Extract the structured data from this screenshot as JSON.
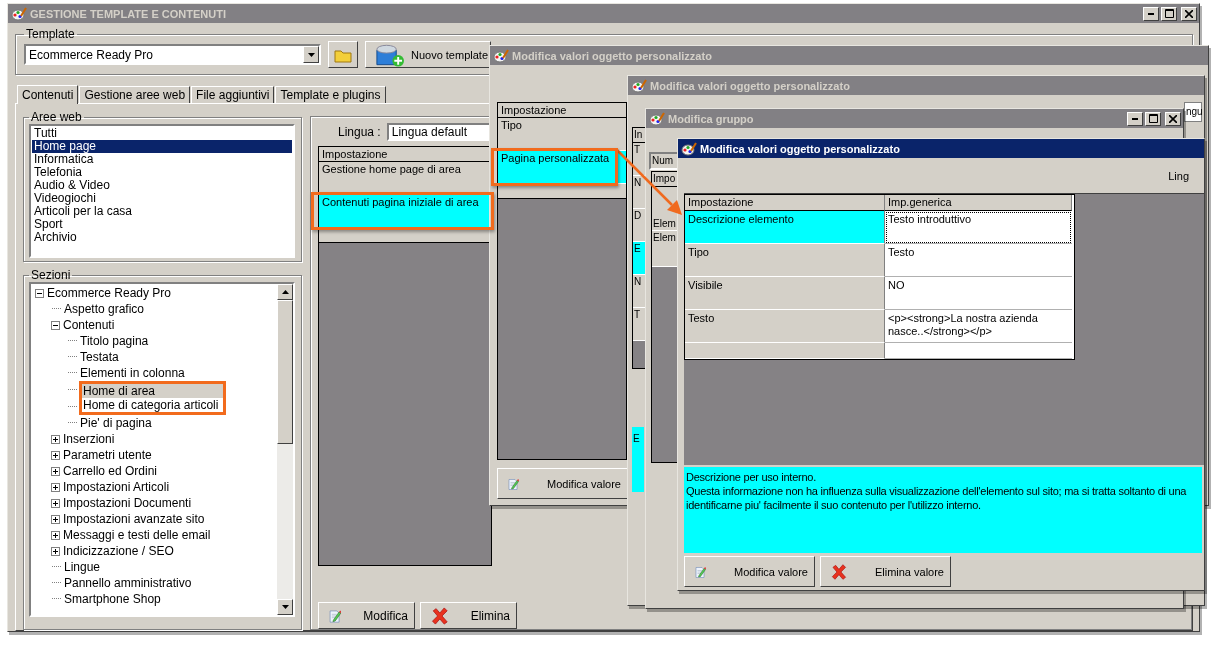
{
  "main_window": {
    "title": "GESTIONE TEMPLATE E CONTENUTI",
    "active": false,
    "template_group": {
      "label": "Template",
      "combo_value": "Ecommerce Ready Pro",
      "new_button": "Nuovo template"
    },
    "tabs": [
      {
        "label": "Contenuti",
        "selected": true
      },
      {
        "label": "Gestione aree web",
        "selected": false
      },
      {
        "label": "File aggiuntivi",
        "selected": false
      },
      {
        "label": "Template e plugins",
        "selected": false
      }
    ],
    "aree_web": {
      "label": "Aree web",
      "items": [
        {
          "label": "Tutti",
          "selected": false
        },
        {
          "label": "Home page",
          "selected": true
        },
        {
          "label": "Informatica",
          "selected": false
        },
        {
          "label": "Telefonia",
          "selected": false
        },
        {
          "label": "Audio & Video",
          "selected": false
        },
        {
          "label": "Videogiochi",
          "selected": false
        },
        {
          "label": "Articoli per la casa",
          "selected": false
        },
        {
          "label": "Sport",
          "selected": false
        },
        {
          "label": "Archivio",
          "selected": false
        }
      ]
    },
    "sezioni": {
      "label": "Sezioni",
      "tree": [
        {
          "label": "Ecommerce Ready Pro",
          "expanded": true,
          "selected": false,
          "highlighted": false,
          "children": [
            {
              "label": "Aspetto grafico",
              "selected": false,
              "highlighted": false
            },
            {
              "label": "Contenuti",
              "expanded": true,
              "selected": false,
              "highlighted": false,
              "children": [
                {
                  "label": "Titolo pagina",
                  "selected": false,
                  "highlighted": false
                },
                {
                  "label": "Testata",
                  "selected": false,
                  "highlighted": false
                },
                {
                  "label": "Elementi in colonna",
                  "selected": false,
                  "highlighted": false
                },
                {
                  "label": "Home di area",
                  "selected": true,
                  "highlighted": true
                },
                {
                  "label": "Home di categoria articoli",
                  "selected": false,
                  "highlighted": true
                },
                {
                  "label": "Pie' di pagina",
                  "selected": false,
                  "highlighted": false
                }
              ]
            },
            {
              "label": "Inserzioni",
              "expanded": false,
              "selected": false,
              "highlighted": false
            },
            {
              "label": "Parametri utente",
              "expanded": false,
              "selected": false,
              "highlighted": false
            },
            {
              "label": "Carrello ed Ordini",
              "expanded": false,
              "selected": false,
              "highlighted": false
            },
            {
              "label": "Impostazioni Articoli",
              "expanded": false,
              "selected": false,
              "highlighted": false
            },
            {
              "label": "Impostazioni Documenti",
              "expanded": false,
              "selected": false,
              "highlighted": false
            },
            {
              "label": "Impostazioni avanzate sito",
              "expanded": false,
              "selected": false,
              "highlighted": false
            },
            {
              "label": "Messaggi e testi delle email",
              "expanded": false,
              "selected": false,
              "highlighted": false
            },
            {
              "label": "Indicizzazione / SEO",
              "expanded": false,
              "selected": false,
              "highlighted": false
            },
            {
              "label": "Lingue",
              "selected": false,
              "highlighted": false
            },
            {
              "label": "Pannello amministrativo",
              "selected": false,
              "highlighted": false
            },
            {
              "label": "Smartphone Shop",
              "selected": false,
              "highlighted": false
            }
          ]
        }
      ]
    },
    "settings_panel": {
      "language_label": "Lingua :",
      "language_value": "Lingua default",
      "column": "Impostazione",
      "rows": [
        {
          "label": "Gestione home page di area",
          "selected": false,
          "highlighted": false
        },
        {
          "label": "Contenuti pagina iniziale di area",
          "selected": true,
          "highlighted": true
        }
      ]
    },
    "buttons": [
      {
        "label": "Modifica",
        "kind": "edit"
      },
      {
        "label": "Elimina",
        "kind": "delete"
      }
    ]
  },
  "dialogs": [
    {
      "kind": "list",
      "title": "Modifica valori oggetto personalizzato",
      "active": false,
      "column": "Impostazione",
      "rows": [
        {
          "label": "Tipo",
          "selected": false,
          "highlighted": false
        },
        {
          "label": "Pagina personalizzata",
          "selected": true,
          "highlighted": true
        }
      ],
      "buttons": [
        {
          "label": "Modifica valore",
          "kind": "edit"
        }
      ]
    },
    {
      "kind": "strip",
      "title": "Modifica valori oggetto personalizzato",
      "active": false,
      "language_fragment": "ngu",
      "column": "In",
      "rows": [
        {
          "label": "T",
          "selected": false
        },
        {
          "label": "N",
          "selected": false
        },
        {
          "label": "D",
          "selected": false
        },
        {
          "label": "E",
          "selected": true
        },
        {
          "label": "N",
          "selected": false
        },
        {
          "label": "T",
          "selected": false
        }
      ],
      "description_fragment": "E"
    },
    {
      "kind": "group",
      "title": "Modifica gruppo",
      "active": false,
      "field_fragment": "Num",
      "column": "Impo",
      "rows": [
        {
          "label": "Elem"
        },
        {
          "label": "Elem"
        }
      ]
    },
    {
      "kind": "properties",
      "title": "Modifica valori oggetto personalizzato",
      "active": true,
      "language_fragment": "Ling",
      "columns": [
        "Impostazione",
        "Imp.generica"
      ],
      "rows": [
        {
          "name": "Descrizione elemento",
          "value": "Testo introduttivo",
          "selected": true
        },
        {
          "name": "Tipo",
          "value": "Testo",
          "selected": false
        },
        {
          "name": "Visibile",
          "value": "NO",
          "selected": false
        },
        {
          "name": "Testo",
          "value": "<p><strong>La nostra azienda nasce..</strong></p>",
          "selected": false
        }
      ],
      "description": "Descrizione per uso interno.\nQuesta informazione non ha influenza sulla visualizzazione dell'elemento sul sito; ma si tratta soltanto di una\nidentificarne piu' facilmente il suo contenuto per l'utilizzo interno.",
      "buttons": [
        {
          "label": "Modifica valore",
          "kind": "edit"
        },
        {
          "label": "Elimina valore",
          "kind": "delete"
        }
      ]
    }
  ],
  "callout_arrow": true
}
